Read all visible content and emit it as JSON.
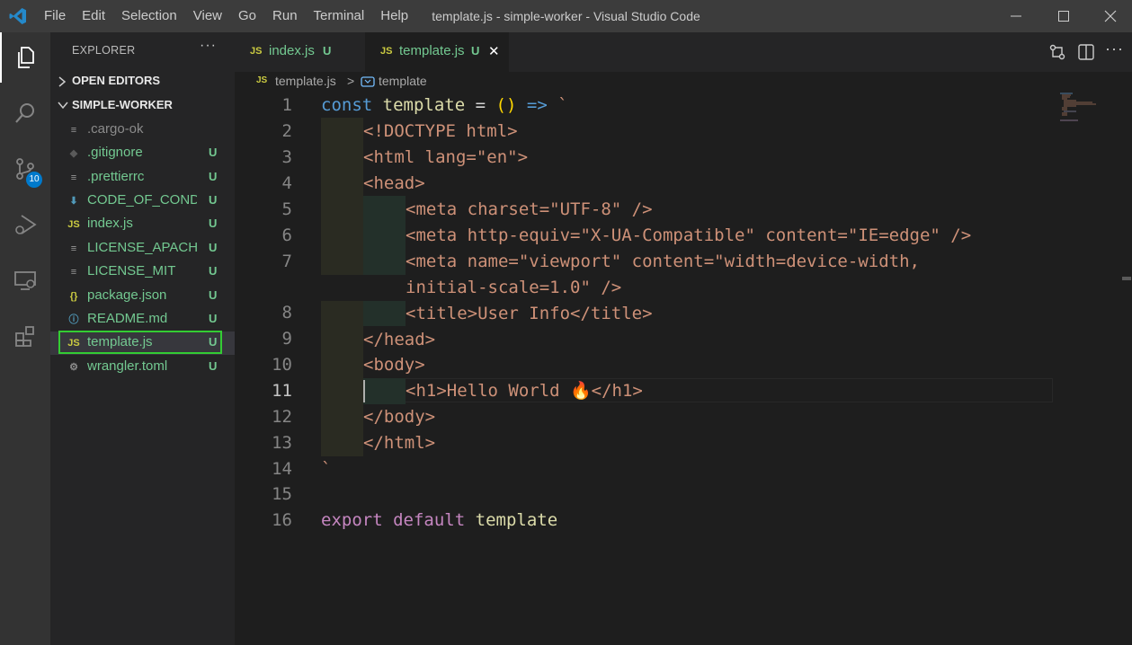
{
  "window": {
    "title": "template.js - simple-worker - Visual Studio Code"
  },
  "menu": [
    "File",
    "Edit",
    "Selection",
    "View",
    "Go",
    "Run",
    "Terminal",
    "Help"
  ],
  "activity_bar": {
    "items": [
      "explorer-icon",
      "search-icon",
      "source-control-icon",
      "run-debug-icon",
      "remote-explorer-icon",
      "extensions-icon"
    ],
    "scm_badge": "10"
  },
  "sidebar": {
    "header": "EXPLORER",
    "more": "···",
    "open_editors": "OPEN EDITORS",
    "folder": "SIMPLE-WORKER",
    "files": [
      {
        "name": ".cargo-ok",
        "status": "",
        "icon": "≡",
        "color": "#8b8b8b",
        "icolor": "#9a9a9a"
      },
      {
        "name": ".gitignore",
        "status": "U",
        "icon": "◆",
        "color": "#73c991",
        "icolor": "#5a5a5a"
      },
      {
        "name": ".prettierrc",
        "status": "U",
        "icon": "≡",
        "color": "#73c991",
        "icolor": "#9a9a9a"
      },
      {
        "name": "CODE_OF_COND...",
        "status": "U",
        "icon": "⬇",
        "color": "#73c991",
        "icolor": "#519aba"
      },
      {
        "name": "index.js",
        "status": "U",
        "icon": "JS",
        "color": "#73c991",
        "icolor": "#cbcb41"
      },
      {
        "name": "LICENSE_APACHE",
        "status": "U",
        "icon": "≡",
        "color": "#73c991",
        "icolor": "#9a9a9a"
      },
      {
        "name": "LICENSE_MIT",
        "status": "U",
        "icon": "≡",
        "color": "#73c991",
        "icolor": "#9a9a9a"
      },
      {
        "name": "package.json",
        "status": "U",
        "icon": "{}",
        "color": "#73c991",
        "icolor": "#cbcb41"
      },
      {
        "name": "README.md",
        "status": "U",
        "icon": "ⓘ",
        "color": "#73c991",
        "icolor": "#519aba"
      },
      {
        "name": "template.js",
        "status": "U",
        "icon": "JS",
        "color": "#73c991",
        "icolor": "#cbcb41"
      },
      {
        "name": "wrangler.toml",
        "status": "U",
        "icon": "⚙",
        "color": "#73c991",
        "icolor": "#8b8b8b"
      }
    ]
  },
  "tabs": [
    {
      "icon": "JS",
      "name": "index.js",
      "status": "U"
    },
    {
      "icon": "JS",
      "name": "template.js",
      "status": "U",
      "close": "✕"
    }
  ],
  "breadcrumb": {
    "file_icon": "JS",
    "file": "template.js",
    "separator": ">",
    "symbol": "template"
  },
  "editor": {
    "current_line": "11",
    "lines": [
      {
        "n": "1",
        "text": "const template = () => `"
      },
      {
        "n": "2",
        "text": "<!DOCTYPE html>"
      },
      {
        "n": "3",
        "text": "<html lang=\"en\">"
      },
      {
        "n": "4",
        "text": "<head>"
      },
      {
        "n": "5",
        "text": "<meta charset=\"UTF-8\" />"
      },
      {
        "n": "6",
        "text": "<meta http-equiv=\"X-UA-Compatible\" content=\"IE=edge\" />"
      },
      {
        "n": "7",
        "text": "<meta name=\"viewport\" content=\"width=device-width,"
      },
      {
        "n": "",
        "text": "initial-scale=1.0\" />"
      },
      {
        "n": "8",
        "text": "<title>User Info</title>"
      },
      {
        "n": "9",
        "text": "</head>"
      },
      {
        "n": "10",
        "text": "<body>"
      },
      {
        "n": "11",
        "text": "<h1>Hello World 🔥</h1>"
      },
      {
        "n": "12",
        "text": "</body>"
      },
      {
        "n": "13",
        "text": "</html>"
      },
      {
        "n": "14",
        "text": "`"
      },
      {
        "n": "15",
        "text": ""
      },
      {
        "n": "16",
        "text": "export default template"
      }
    ]
  },
  "colors": {
    "accent": "#007acc",
    "untracked": "#73c991",
    "selection_outline": "#33cc33",
    "keyword": "#569cd6",
    "string": "#ce9178",
    "function": "#dcdcaa",
    "export": "#c586c0"
  }
}
